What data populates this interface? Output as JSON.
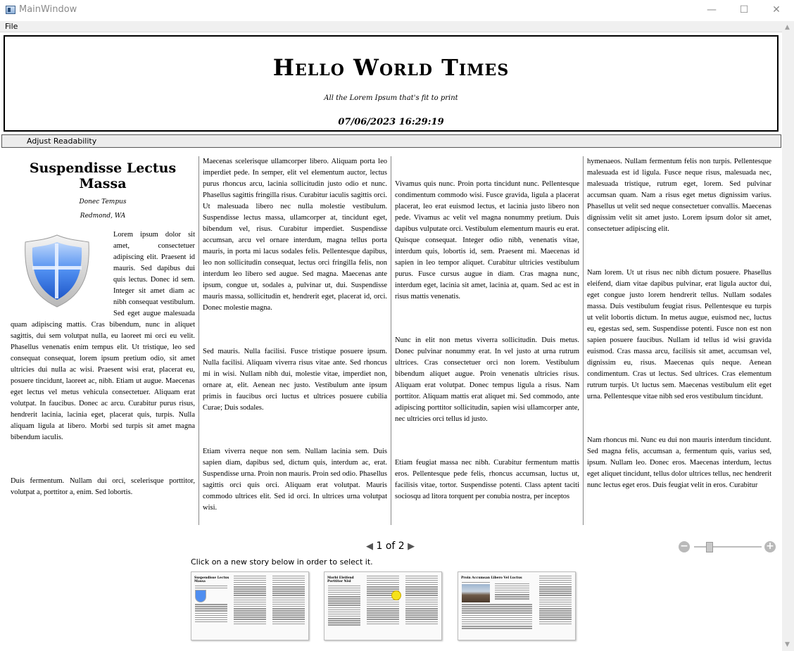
{
  "window": {
    "title": "MainWindow",
    "minimize": "—",
    "maximize": "☐",
    "close": "✕"
  },
  "menu": {
    "file": "File"
  },
  "masthead": {
    "title": "Hello World Times",
    "tagline": "All the Lorem Ipsum that's fit to print",
    "date": "07/06/2023 16:29:19"
  },
  "toolbar": {
    "adjust_readability": "Adjust Readability"
  },
  "story": {
    "title": "Suspendisse Lectus Massa",
    "author": "Donec Tempus",
    "location": "Redmond, WA",
    "image_icon": "shield-icon",
    "col1": [
      "Lorem ipsum dolor sit amet, consectetuer adipiscing elit. Praesent id mauris. Sed dapibus dui quis lectus. Donec id sem. Integer sit amet diam ac nibh consequat vestibulum. Sed eget augue malesuada quam adipiscing mattis. Cras bibendum, nunc in aliquet sagittis, dui sem volutpat nulla, eu laoreet mi orci eu velit. Phasellus venenatis enim tempus elit. Ut tristique, leo sed consequat consequat, lorem ipsum pretium odio, sit amet ultricies dui nulla ac wisi. Praesent wisi erat, placerat eu, posuere tincidunt, laoreet ac, nibh. Etiam ut augue. Maecenas eget lectus vel metus vehicula consectetuer. Aliquam erat volutpat. In faucibus. Donec ac arcu. Curabitur purus risus, hendrerit lacinia, lacinia eget, placerat quis, turpis. Nulla aliquam ligula at libero. Morbi sed turpis sit amet magna bibendum iaculis.",
      "Duis fermentum. Nullam dui orci, scelerisque porttitor, volutpat a, porttitor a, enim. Sed lobortis."
    ],
    "col2": [
      "Maecenas scelerisque ullamcorper libero. Aliquam porta leo imperdiet pede. In semper, elit vel elementum auctor, lectus purus rhoncus arcu, lacinia sollicitudin justo odio et nunc. Phasellus sagittis fringilla risus. Curabitur iaculis sagittis orci. Ut malesuada libero nec nulla molestie vestibulum. Suspendisse lectus massa, ullamcorper at, tincidunt eget, bibendum vel, risus. Curabitur imperdiet. Suspendisse accumsan, arcu vel ornare interdum, magna tellus porta mauris, in porta mi lacus sodales felis. Pellentesque dapibus, leo non sollicitudin consequat, lectus orci fringilla felis, non interdum leo libero sed augue. Sed magna. Maecenas ante ipsum, congue ut, sodales a, pulvinar ut, dui. Suspendisse mauris massa, sollicitudin et, hendrerit eget, placerat id, orci. Donec molestie magna.",
      "Sed mauris. Nulla facilisi. Fusce tristique posuere ipsum. Nulla facilisi. Aliquam viverra risus vitae ante. Sed rhoncus mi in wisi. Nullam nibh dui, molestie vitae, imperdiet non, ornare at, elit. Aenean nec justo. Vestibulum ante ipsum primis in faucibus orci luctus et ultrices posuere cubilia Curae; Duis sodales.",
      "Etiam viverra neque non sem. Nullam lacinia sem. Duis sapien diam, dapibus sed, dictum quis, interdum ac, erat. Suspendisse urna. Proin non mauris. Proin sed odio. Phasellus sagittis orci quis orci. Aliquam erat volutpat. Mauris commodo ultrices elit. Sed id orci. In ultrices urna volutpat wisi."
    ],
    "col3": [
      "Vivamus quis nunc. Proin porta tincidunt nunc. Pellentesque condimentum commodo wisi. Fusce gravida, ligula a placerat placerat, leo erat euismod lectus, et lacinia justo libero non pede. Vivamus ac velit vel magna nonummy pretium. Duis dapibus vulputate orci. Vestibulum elementum mauris eu erat. Quisque consequat. Integer odio nibh, venenatis vitae, interdum quis, lobortis id, sem. Praesent mi. Maecenas id sapien in leo tempor aliquet. Curabitur ultricies vestibulum purus. Fusce cursus augue in diam. Cras magna nunc, interdum eget, lacinia sit amet, lacinia at, quam. Sed ac est in risus mattis venenatis.",
      "Nunc in elit non metus viverra sollicitudin. Duis metus. Donec pulvinar nonummy erat. In vel justo at urna rutrum ultrices. Cras consectetuer orci non lorem. Vestibulum bibendum aliquet augue. Proin venenatis ultricies risus. Aliquam erat volutpat. Donec tempus ligula a risus. Nam porttitor. Aliquam mattis erat aliquet mi. Sed commodo, ante adipiscing porttitor sollicitudin, sapien wisi ullamcorper ante, nec ultricies orci tellus id justo.",
      "Etiam feugiat massa nec nibh. Curabitur fermentum mattis eros. Pellentesque pede felis, rhoncus accumsan, luctus ut, facilisis vitae, tortor. Suspendisse potenti. Class aptent taciti sociosqu ad litora torquent per conubia nostra, per inceptos"
    ],
    "col4": [
      "hymenaeos. Nullam fermentum felis non turpis. Pellentesque malesuada est id ligula. Fusce neque risus, malesuada nec, malesuada tristique, rutrum eget, lorem. Sed pulvinar accumsan quam. Nam a risus eget metus dignissim varius. Phasellus ut velit sed neque consectetuer convallis. Maecenas dignissim velit sit amet justo. Lorem ipsum dolor sit amet, consectetuer adipiscing elit.",
      "Nam lorem. Ut ut risus nec nibh dictum posuere. Phasellus eleifend, diam vitae dapibus pulvinar, erat ligula auctor dui, eget congue justo lorem hendrerit tellus. Nullam sodales massa. Duis vestibulum feugiat risus. Pellentesque eu turpis ut velit lobortis dictum. In metus augue, euismod nec, luctus eu, egestas sed, sem. Suspendisse potenti. Fusce non est non sapien posuere faucibus. Nullam id tellus id wisi gravida euismod. Cras massa arcu, facilisis sit amet, accumsan vel, dignissim eu, risus. Maecenas quis neque. Aenean condimentum. Cras ut lectus. Sed ultrices. Cras elementum rutrum turpis. Ut luctus sem. Maecenas vestibulum elit eget urna. Pellentesque vitae nibh sed eros vestibulum tincidunt.",
      "Nam rhoncus mi. Nunc eu dui non mauris interdum tincidunt. Sed magna felis, accumsan a, fermentum quis, varius sed, ipsum. Nullam leo. Donec eros. Maecenas interdum, lectus eget aliquet tincidunt, tellus dolor ultrices tellus, nec hendrerit nunc lectus eget eros. Duis feugiat velit in eros. Curabitur"
    ]
  },
  "pager": {
    "prev_icon": "chevron-left-icon",
    "current": "1",
    "of": "of",
    "total": "2",
    "next_icon": "chevron-right-icon"
  },
  "zoom": {
    "minus": "−",
    "plus": "+",
    "level": 0.2
  },
  "stories": {
    "hint": "Click on a new story below in order to select it.",
    "thumbnails": [
      {
        "title": "Suspendisse Lectus Massa",
        "icon": "shield-icon"
      },
      {
        "title": "Morbi Eleifend Porttitor Nisl",
        "icon": "smiley-icon"
      },
      {
        "title": "Proin Accumsan Libero Vel Luctus",
        "icon": "landscape-photo-icon"
      }
    ]
  },
  "colors": {
    "accent_blue": "#2f6fd6",
    "border": "#000000",
    "toolbar_bg": "#ececec"
  }
}
